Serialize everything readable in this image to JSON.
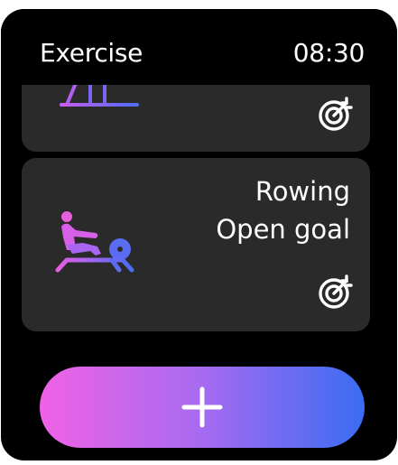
{
  "header": {
    "title": "Exercise",
    "time": "08:30"
  },
  "cards": [
    {
      "name": "",
      "goal": "",
      "icon": "treadmill-icon",
      "goal_icon": "target-icon"
    },
    {
      "name": "Rowing",
      "goal": "Open goal",
      "icon": "rowing-machine-icon",
      "goal_icon": "target-icon"
    }
  ],
  "add_button": {
    "icon": "plus-icon"
  },
  "colors": {
    "background": "#000000",
    "card": "#2a2a2a",
    "text": "#ffffff",
    "gradient_start": "#f062e6",
    "gradient_end": "#3a6cf2"
  }
}
